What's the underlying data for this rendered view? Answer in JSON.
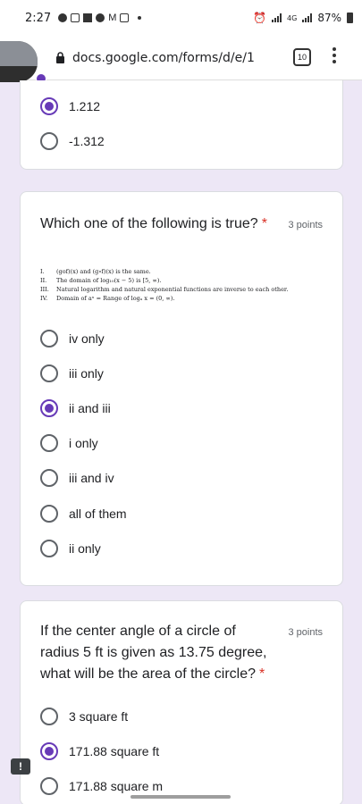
{
  "status_bar": {
    "time": "2:27",
    "battery": "87%",
    "network": "4G"
  },
  "browser": {
    "url": "docs.google.com/forms/d/e/1",
    "tab_count": "10"
  },
  "prev_question": {
    "options": [
      {
        "label": "1.212",
        "checked": true
      },
      {
        "label": "-1.312",
        "checked": false
      }
    ]
  },
  "question1": {
    "title": "Which one of the following is true?",
    "required_mark": "*",
    "points": "3 points",
    "statements": [
      {
        "num": "I.",
        "text": "(gof)(x) and (g∘f)(x) is the same."
      },
      {
        "num": "II.",
        "text": "The domain of log₁₀(x − 5) is [5, ∞)."
      },
      {
        "num": "III.",
        "text": "Natural logarithm and natural exponential functions are inverse to each other."
      },
      {
        "num": "IV.",
        "text": "Domain of aˣ = Range of logₐ x = (0, ∞)."
      }
    ],
    "options": [
      {
        "label": "iv only",
        "checked": false
      },
      {
        "label": "iii only",
        "checked": false
      },
      {
        "label": "ii and iii",
        "checked": true
      },
      {
        "label": "i only",
        "checked": false
      },
      {
        "label": "iii and iv",
        "checked": false
      },
      {
        "label": "all of them",
        "checked": false
      },
      {
        "label": "ii only",
        "checked": false
      }
    ]
  },
  "question2": {
    "title_line1": "If the center angle of a circle of",
    "title_line2": "radius 5 ft is given as 13.75 degree,",
    "title_line3": "what will be the area of the circle?",
    "required_mark": "*",
    "points": "3 points",
    "options": [
      {
        "label": "3 square ft",
        "checked": false
      },
      {
        "label": "171.88 square ft",
        "checked": true
      },
      {
        "label": "171.88 square m",
        "checked": false
      }
    ]
  },
  "report_button": "!",
  "colors": {
    "accent": "#673ab7",
    "background": "#ede7f6",
    "required": "#d93025"
  }
}
